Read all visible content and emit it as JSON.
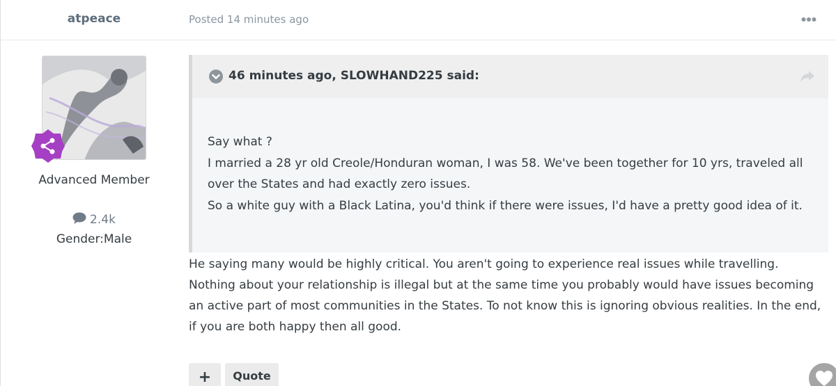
{
  "post": {
    "author": "atpeace",
    "posted_time": "Posted 14 minutes ago"
  },
  "author_info": {
    "member_title": "Advanced Member",
    "post_count": "2.4k",
    "gender": "Gender:Male",
    "badge_color": "#a53fc4"
  },
  "quote": {
    "citation": "46 minutes ago, SLOWHAND225 said:",
    "lines": [
      "Say what ?",
      "I married a 28 yr old Creole/Honduran woman, I was 58. We've been together for 10 yrs, traveled all over the States and had exactly zero issues.",
      "So a white guy with a Black Latina, you'd think if there were issues, I'd have a pretty good idea of it."
    ]
  },
  "body": "He saying many would be highly critical.  You aren't going to experience real issues while travelling.  Nothing about your relationship is illegal but at the same time you probably would have issues becoming an active part of most communities in the States.  To not know this is ignoring obvious realities.  In the end, if you are both happy then all good.",
  "actions": {
    "plus_label": "+",
    "quote_label": "Quote"
  },
  "icons": {
    "more": "more-options-icon",
    "collapse": "chevron-down-circle-icon",
    "share": "share-arrow-icon",
    "comment": "comment-bubble-icon",
    "badge": "share-nodes-icon",
    "like": "heart-icon"
  }
}
